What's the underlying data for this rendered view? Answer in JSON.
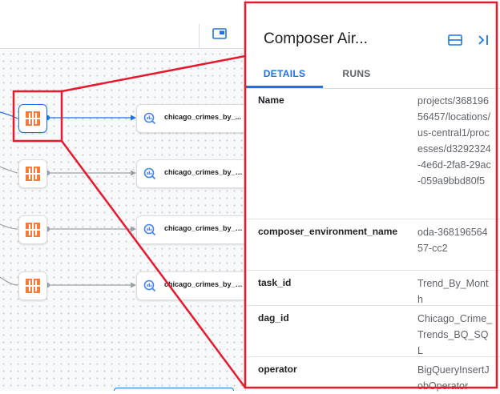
{
  "canvas": {
    "nodes": [
      {
        "label": "chicago_crimes_by_..."
      },
      {
        "label": "chicago_crimes_by_h..."
      },
      {
        "label": "chicago_crimes_by_d..."
      },
      {
        "label": "chicago_crimes_by_y..."
      }
    ]
  },
  "panel": {
    "title": "Composer Air...",
    "tabs": [
      {
        "label": "DETAILS",
        "active": true
      },
      {
        "label": "RUNS",
        "active": false
      }
    ],
    "rows": [
      {
        "key": "Name",
        "value": "projects/36819656457/locations/us-central1/processes/d3292324-4e6d-2fa8-29ac-059a9bbd80f5"
      },
      {
        "key": "composer_environment_name",
        "value": "oda-36819656457-cc2"
      },
      {
        "key": "task_id",
        "value": "Trend_By_Month"
      },
      {
        "key": "dag_id",
        "value": "Chicago_Crime_Trends_BQ_SQL"
      },
      {
        "key": "operator",
        "value": "BigQueryInsertJobOperator"
      }
    ]
  },
  "colors": {
    "accent": "#1a73e8",
    "operator_orange": "#f27d3a",
    "highlight_red": "#e8192c"
  }
}
